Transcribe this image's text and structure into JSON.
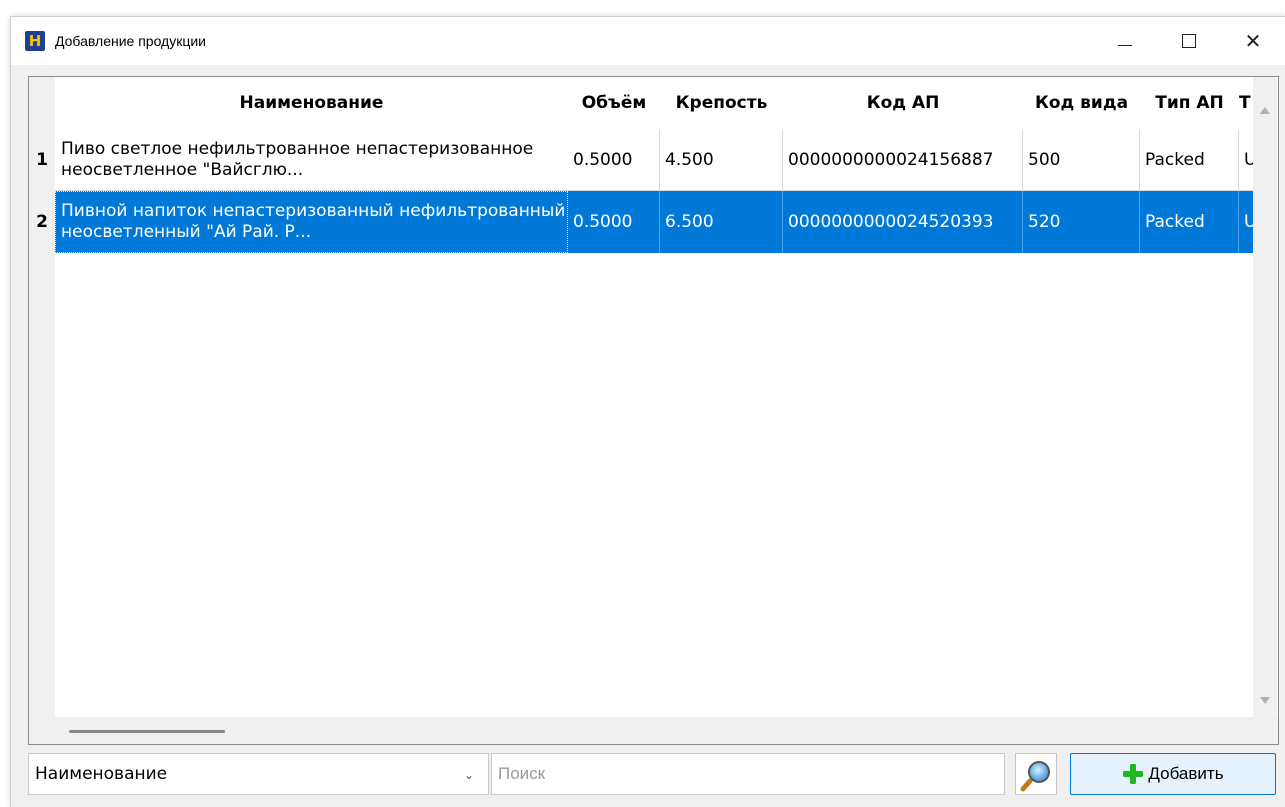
{
  "window": {
    "title": "Добавление продукции",
    "app_icon_letter": "H",
    "controls": {
      "minimize": "—",
      "maximize": "□",
      "close": "✕"
    }
  },
  "table": {
    "columns": [
      "Наименование",
      "Объём",
      "Крепость",
      "Код АП",
      "Код вида",
      "Тип АП",
      "Т"
    ],
    "rows": [
      {
        "num": "1",
        "name": "Пиво светлое нефильтрованное непастеризованное неосветленное \"Вайсглю...",
        "volume": "0.5000",
        "strength": "4.500",
        "code_ap": "0000000000024156887",
        "kind_code": "500",
        "type_ap": "Packed",
        "extra": "U",
        "selected": false
      },
      {
        "num": "2",
        "name": "Пивной напиток непастеризованный нефильтрованный неосветленный \"Ай Рай. Р...",
        "volume": "0.5000",
        "strength": "6.500",
        "code_ap": "0000000000024520393",
        "kind_code": "520",
        "type_ap": "Packed",
        "extra": "U",
        "selected": true
      }
    ],
    "selection_color": "#0078d7"
  },
  "search": {
    "field_selected": "Наименование",
    "placeholder": "Поиск",
    "value": "",
    "search_icon": "magnifier-icon"
  },
  "add_button": {
    "label": "Добавить",
    "icon": "plus-icon",
    "icon_color": "#1fb81f",
    "border_color": "#0078d7"
  }
}
